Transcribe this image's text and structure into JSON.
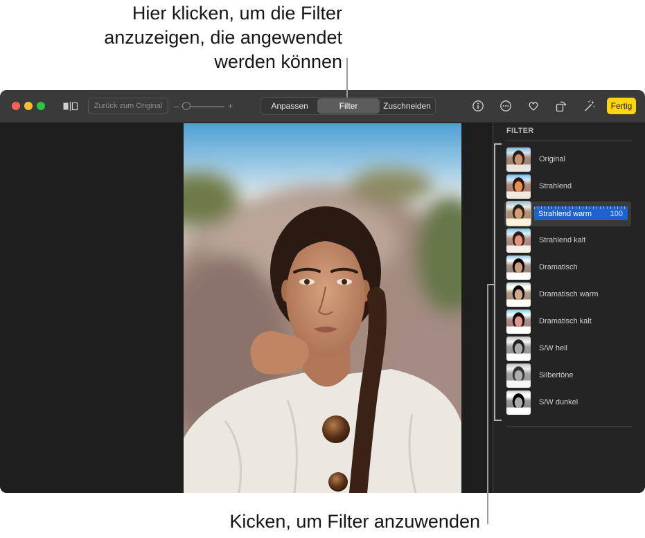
{
  "callouts": {
    "top": [
      "Hier klicken, um die Filter",
      "anzuzeigen, die angewendet",
      "werden können"
    ],
    "bottom": "Kicken, um Filter anzuwenden"
  },
  "toolbar": {
    "window_controls": [
      "close-button",
      "minimize-button",
      "zoom-button"
    ],
    "compare_icon": "compare-icon",
    "revert_label": "Zurück zum Original",
    "zoom_minus": "–",
    "zoom_plus": "+",
    "zoom_level": 0.12,
    "tabs": [
      {
        "label": "Anpassen",
        "selected": false
      },
      {
        "label": "Filter",
        "selected": true
      },
      {
        "label": "Zuschneiden",
        "selected": false
      }
    ],
    "icons": [
      "info-icon",
      "more-icon",
      "heart-icon",
      "rotate-icon",
      "magic-wand-icon"
    ],
    "done_label": "Fertig"
  },
  "sidebar": {
    "title": "FILTER",
    "filters": [
      {
        "name": "Original"
      },
      {
        "name": "Strahlend"
      },
      {
        "name": "Strahlend warm",
        "selected": true,
        "intensity": 100
      },
      {
        "name": "Strahlend kalt"
      },
      {
        "name": "Dramatisch"
      },
      {
        "name": "Dramatisch warm"
      },
      {
        "name": "Dramatisch kalt"
      },
      {
        "name": "S/W hell"
      },
      {
        "name": "Silbertöne"
      },
      {
        "name": "S/W dunkel"
      }
    ]
  },
  "colors": {
    "close": "#ff5f57",
    "minimize": "#febc2e",
    "zoom": "#28c840",
    "done_button": "#ffd60a",
    "selected_filter": "#1e62d0"
  }
}
